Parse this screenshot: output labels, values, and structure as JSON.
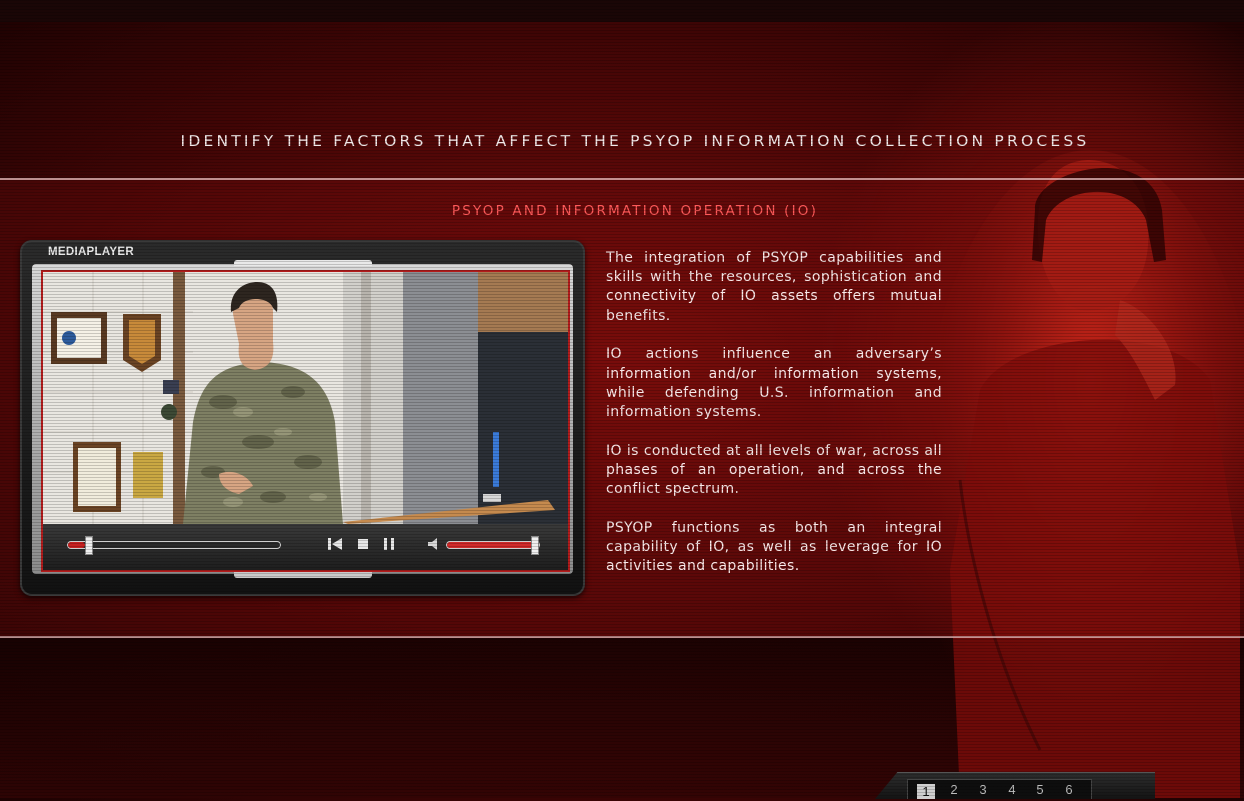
{
  "page": {
    "title": "IDENTIFY THE FACTORS THAT AFFECT THE PSYOP INFORMATION COLLECTION PROCESS",
    "section_title": "PSYOP AND INFORMATION OPERATION (IO)"
  },
  "player": {
    "label": "MEDIAPLAYER",
    "seek_progress": 0.08,
    "volume_level": 0.95,
    "controls": [
      "skip-back-icon",
      "stop-icon",
      "pause-icon",
      "speaker-icon"
    ]
  },
  "content": {
    "paragraphs": [
      "The integration of PSYOP capabilities and skills with the resources, sophistication and connectivity of IO assets offers mutual benefits.",
      "IO actions influence an adversary’s information and/or information systems, while defending U.S. information and information systems.",
      "IO is conducted at all levels of war, across all phases of an operation, and across the conflict spectrum.",
      "PSYOP functions as both an integral capability of IO, as well as leverage for IO activities and capabilities."
    ]
  },
  "pager": {
    "pages": [
      "1",
      "2",
      "3",
      "4",
      "5",
      "6"
    ],
    "current": "1"
  },
  "colors": {
    "accent_red": "#ff5a5a",
    "frame_red": "#b21c1c",
    "background_red": "#7a0d0b"
  }
}
